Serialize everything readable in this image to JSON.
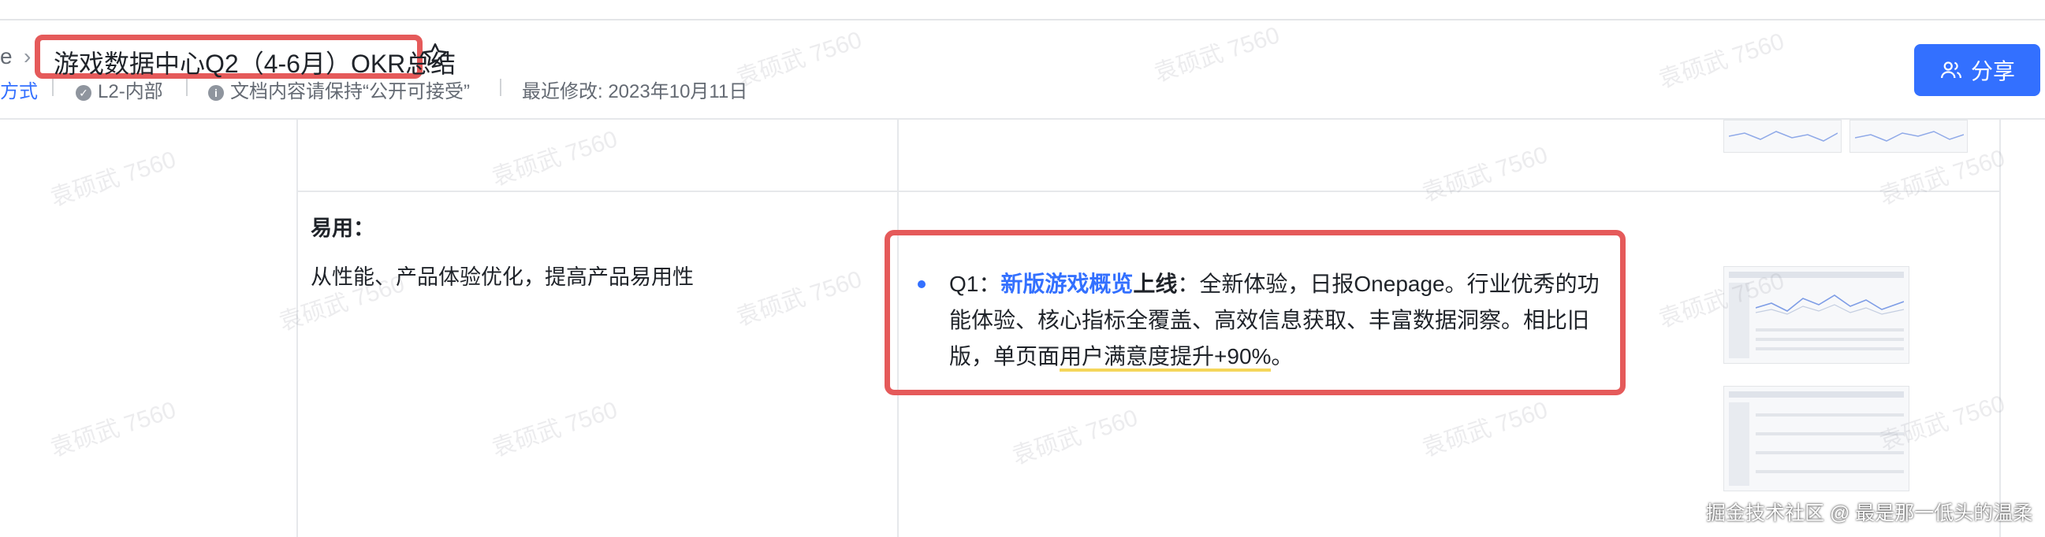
{
  "breadcrumb": {
    "prev_fragment": "e",
    "separator": "›"
  },
  "doc": {
    "title": "游戏数据中心Q2（4-6月）OKR总结"
  },
  "meta": {
    "link_fragment": "方式",
    "security": "L2-内部",
    "note": "文档内容请保持“公开可接受”",
    "last_modified": "最近修改: 2023年10月11日"
  },
  "share": {
    "label": "分享"
  },
  "table": {
    "left_heading": "易用：",
    "left_desc": "从性能、产品体验优化，提高产品易用性",
    "right": {
      "q_label": "Q1：",
      "link_text": "新版游戏概览",
      "bold_text": "上线",
      "text_1": "：全新体验，日报Onepage。行业优秀的功能体验、核心指标全覆盖、高效信息获取、丰富数据洞察。相比旧版，单页面",
      "underlined_text": "用户满意度提升+90%",
      "text_end": "。"
    }
  },
  "watermark": {
    "text": "袁硕武 7560"
  },
  "credit": "掘金技术社区 @ 最是那一低头的温柔",
  "colors": {
    "accent": "#3370ff",
    "annotation_red": "#e55a5a",
    "underline": "#f5d65b"
  },
  "icons": {
    "star": "star-icon",
    "shield": "shield-check-icon",
    "info": "info-icon",
    "share": "users-icon"
  }
}
